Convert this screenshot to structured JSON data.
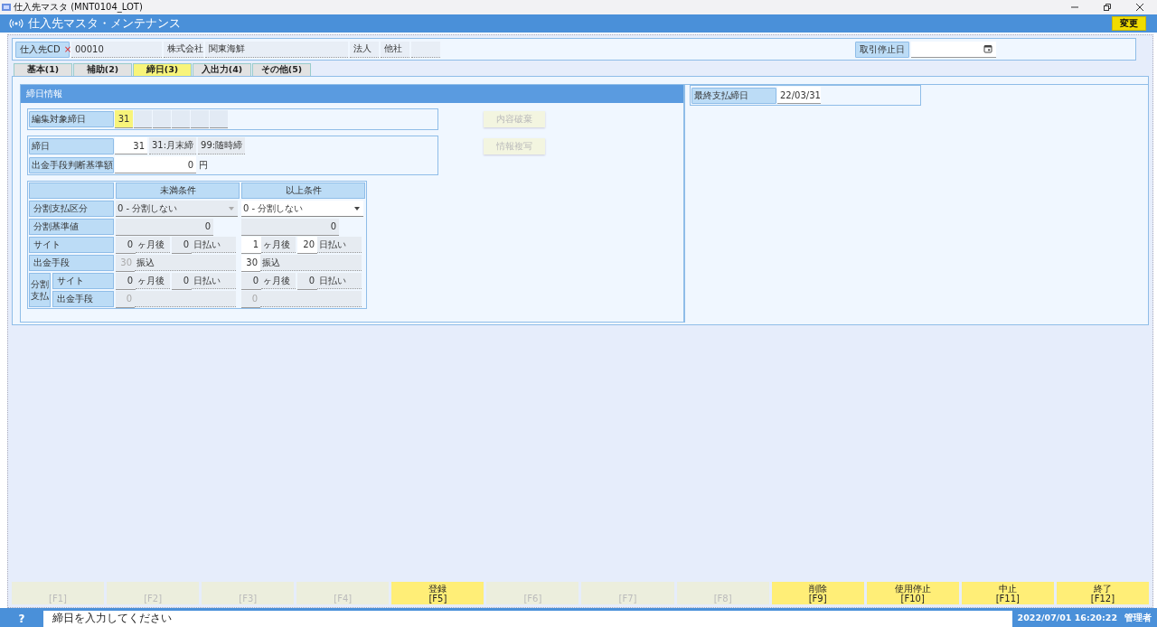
{
  "window": {
    "title": "仕入先マスタ (MNT0104_LOT)"
  },
  "header": {
    "title": "仕入先マスタ・メンテナンス",
    "action_button": "変更"
  },
  "supplier": {
    "code_label": "仕入先CD",
    "required_mark": "×",
    "code": "00010",
    "name_prefix": "株式会社",
    "name": "関東海鮮",
    "corporate_type": "法人",
    "category": "他社",
    "stop_date_label": "取引停止日"
  },
  "tabs": [
    {
      "label": "基本(1)",
      "selected": false
    },
    {
      "label": "補助(2)",
      "selected": false
    },
    {
      "label": "締日(3)",
      "selected": true
    },
    {
      "label": "入出力(4)",
      "selected": false
    },
    {
      "label": "その他(5)",
      "selected": false
    }
  ],
  "closing_info": {
    "heading": "締日情報",
    "target_days": {
      "label": "編集対象締日",
      "cells": [
        {
          "value": "31",
          "selected": true
        },
        {
          "selected": false
        },
        {
          "selected": false
        },
        {
          "selected": false
        },
        {
          "selected": false
        },
        {
          "selected": false
        }
      ]
    },
    "closing_day": {
      "label": "締日",
      "value": "31",
      "hints": [
        "31:月末締",
        "99:随時締"
      ]
    },
    "threshold": {
      "label": "出金手段判断基準額",
      "value": "0",
      "unit": "円"
    },
    "buttons": [
      {
        "label": "内容破棄",
        "disabled": true
      },
      {
        "label": "情報複写",
        "disabled": true
      }
    ],
    "conditions": {
      "columns": [
        "未満条件",
        "以上条件"
      ],
      "rows": [
        {
          "kind": "select",
          "label": "分割支払区分",
          "cells": [
            {
              "value": "0 - 分割しない",
              "disabled": true
            },
            {
              "value": "0 - 分割しない",
              "disabled": false
            }
          ]
        },
        {
          "kind": "number",
          "label": "分割基準値",
          "cells": [
            {
              "value": "0",
              "disabled": true
            },
            {
              "value": "0",
              "disabled": true
            }
          ]
        },
        {
          "kind": "site",
          "label": "サイト",
          "cells": [
            {
              "months": "0",
              "month_unit": "ヶ月後",
              "days": "0",
              "day_unit": "日払い",
              "disabled": true
            },
            {
              "months": "1",
              "month_unit": "ヶ月後",
              "days": "20",
              "day_unit": "日払い",
              "disabled": false
            }
          ]
        },
        {
          "kind": "method",
          "label": "出金手段",
          "cells": [
            {
              "code": "30",
              "name": "振込",
              "disabled": true
            },
            {
              "code": "30",
              "name": "振込",
              "disabled": false
            }
          ]
        },
        {
          "kind": "group",
          "label": "分割支払",
          "children": [
            {
              "kind": "site",
              "label": "サイト",
              "cells": [
                {
                  "months": "0",
                  "month_unit": "ヶ月後",
                  "days": "0",
                  "day_unit": "日払い",
                  "disabled": true
                },
                {
                  "months": "0",
                  "month_unit": "ヶ月後",
                  "days": "0",
                  "day_unit": "日払い",
                  "disabled": true
                }
              ]
            },
            {
              "kind": "method",
              "label": "出金手段",
              "cells": [
                {
                  "code": "0",
                  "disabled": true
                },
                {
                  "code": "0",
                  "disabled": true
                }
              ]
            }
          ]
        }
      ]
    }
  },
  "last_payment": {
    "label": "最終支払締日",
    "value": "22/03/31"
  },
  "function_keys": [
    {
      "key": "[F1]",
      "disabled": true
    },
    {
      "key": "[F2]",
      "disabled": true
    },
    {
      "key": "[F3]",
      "disabled": true
    },
    {
      "key": "[F4]",
      "disabled": true
    },
    {
      "label": "登録",
      "key": "[F5]",
      "disabled": false
    },
    {
      "key": "[F6]",
      "disabled": true
    },
    {
      "key": "[F7]",
      "disabled": true
    },
    {
      "key": "[F8]",
      "disabled": true
    },
    {
      "label": "削除",
      "key": "[F9]",
      "disabled": false
    },
    {
      "label": "使用停止",
      "key": "[F10]",
      "disabled": false
    },
    {
      "label": "中止",
      "key": "[F11]",
      "disabled": false
    },
    {
      "label": "終了",
      "key": "[F12]",
      "disabled": false
    }
  ],
  "status_bar": {
    "help": "?",
    "message": "締日を入力してください",
    "datetime": "2022/07/01 16:20:22",
    "user": "管理者"
  }
}
